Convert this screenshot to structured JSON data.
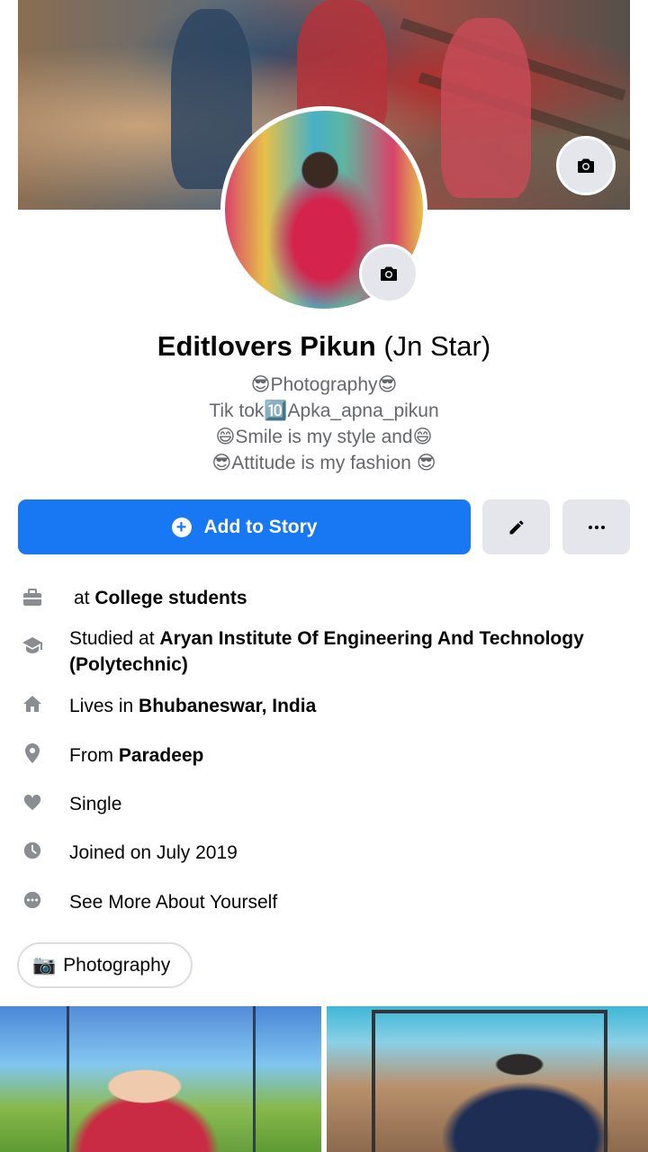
{
  "profile": {
    "name": "Editlovers Pikun",
    "alt_name": "(Jn Star)",
    "bio_lines": [
      "😎Photography😎",
      "Tik tok🔟Apka_apna_pikun",
      "😄Smile is my style and😄",
      "😎Attitude is my fashion 😎"
    ]
  },
  "actions": {
    "add_story_label": "Add to Story",
    "edit_icon": "pencil-icon",
    "more_icon": "more-dots-icon"
  },
  "info": {
    "work": {
      "prefix": "at ",
      "value": "College students",
      "icon": "briefcase-icon"
    },
    "education": {
      "prefix": "Studied at ",
      "value": "Aryan Institute Of Engineering And Technology (Polytechnic)",
      "icon": "graduation-cap-icon"
    },
    "lives": {
      "prefix": "Lives in ",
      "value": "Bhubaneswar, India",
      "icon": "home-icon"
    },
    "from": {
      "prefix": "From ",
      "value": "Paradeep",
      "icon": "location-pin-icon"
    },
    "relationship": {
      "value": "Single",
      "icon": "heart-icon"
    },
    "joined": {
      "value": "Joined on July 2019",
      "icon": "clock-icon"
    },
    "see_more": {
      "value": "See More About Yourself",
      "icon": "more-circle-icon"
    }
  },
  "hobby_chip": {
    "emoji": "📷",
    "label": "Photography"
  },
  "colors": {
    "primary": "#1877f2",
    "button_grey": "#e4e6eb",
    "secondary_text": "#65676b"
  }
}
